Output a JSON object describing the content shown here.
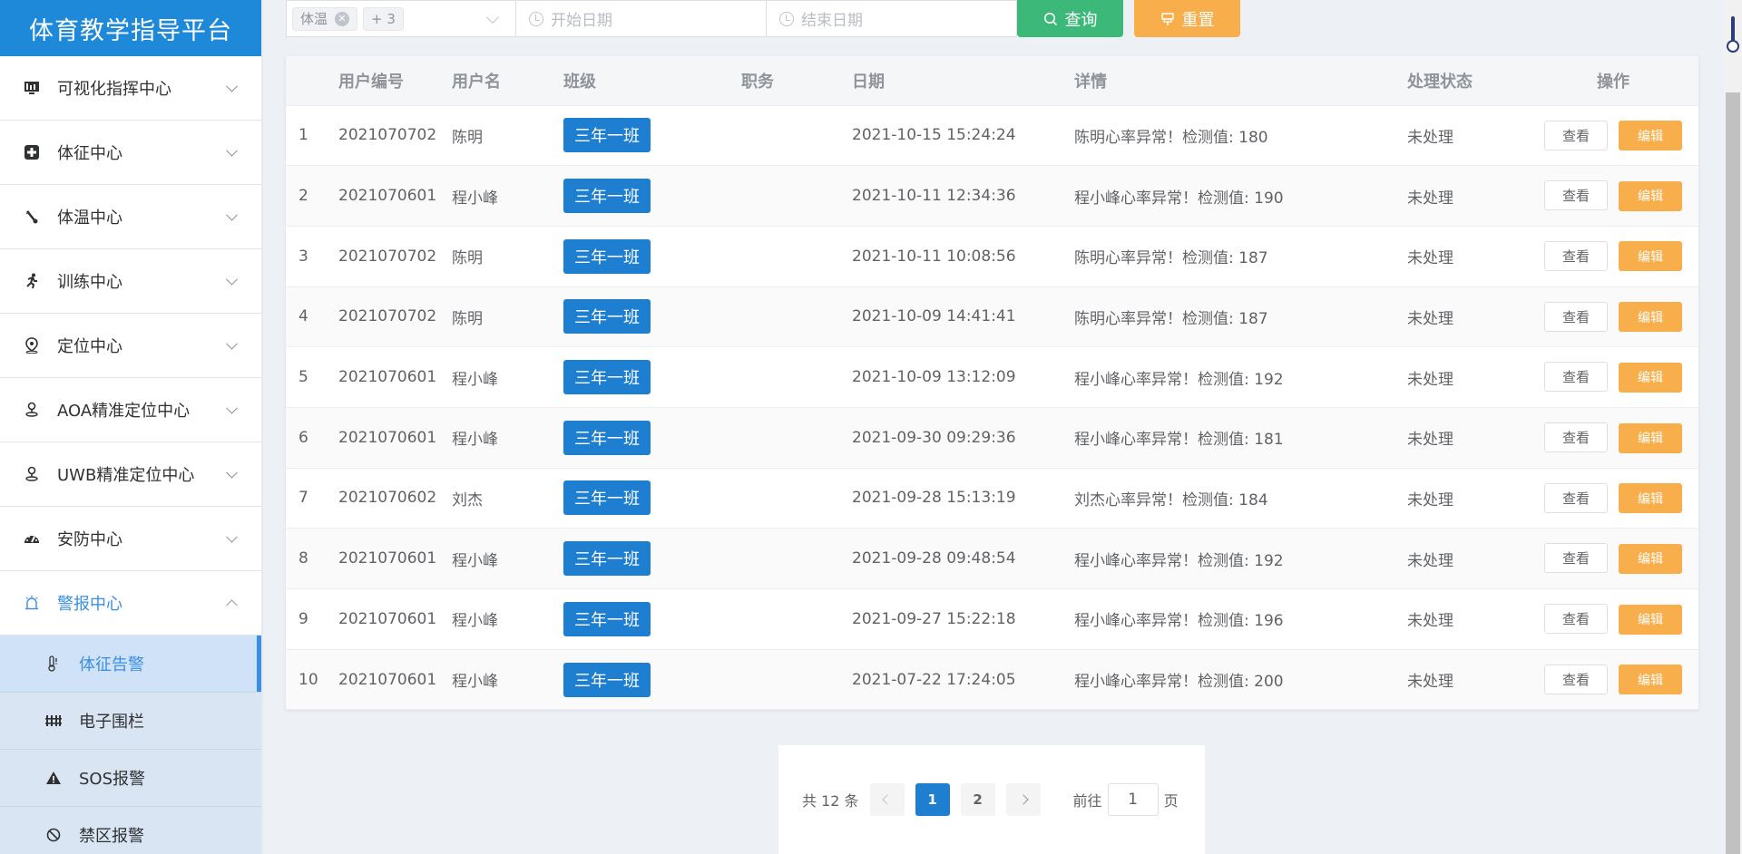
{
  "sidebar": {
    "title": "体育教学指导平台",
    "menu": [
      {
        "label": "可视化指挥中心",
        "icon": "monitor-icon"
      },
      {
        "label": "体征中心",
        "icon": "medical-cross-icon"
      },
      {
        "label": "体温中心",
        "icon": "thermometer-icon"
      },
      {
        "label": "训练中心",
        "icon": "running-icon"
      },
      {
        "label": "定位中心",
        "icon": "location-pin-icon"
      },
      {
        "label": "AOA精准定位中心",
        "icon": "locate-person-icon"
      },
      {
        "label": "UWB精准定位中心",
        "icon": "locate-person-icon"
      },
      {
        "label": "安防中心",
        "icon": "gauge-icon"
      },
      {
        "label": "警报中心",
        "icon": "alarm-icon"
      }
    ],
    "submenu": [
      {
        "label": "体征告警",
        "icon": "temperature-alert-icon"
      },
      {
        "label": "电子围栏",
        "icon": "fence-icon"
      },
      {
        "label": "SOS报警",
        "icon": "warning-icon"
      },
      {
        "label": "禁区报警",
        "icon": "forbidden-icon"
      }
    ]
  },
  "filters": {
    "type_tag": "体温",
    "more_tag": "+ 3",
    "start_placeholder": "开始日期",
    "end_placeholder": "结束日期",
    "query_label": "查询",
    "reset_label": "重置"
  },
  "table": {
    "headers": [
      "",
      "用户编号",
      "用户名",
      "班级",
      "职务",
      "日期",
      "详情",
      "处理状态",
      "操作"
    ],
    "rows": [
      {
        "idx": "1",
        "user_id": "2021070702",
        "name": "陈明",
        "class": "三年一班",
        "role": "",
        "date": "2021-10-15 15:24:24",
        "detail": "陈明心率异常！检测值: 180",
        "status": "未处理"
      },
      {
        "idx": "2",
        "user_id": "2021070601",
        "name": "程小峰",
        "class": "三年一班",
        "role": "",
        "date": "2021-10-11 12:34:36",
        "detail": "程小峰心率异常！检测值: 190",
        "status": "未处理"
      },
      {
        "idx": "3",
        "user_id": "2021070702",
        "name": "陈明",
        "class": "三年一班",
        "role": "",
        "date": "2021-10-11 10:08:56",
        "detail": "陈明心率异常！检测值: 187",
        "status": "未处理"
      },
      {
        "idx": "4",
        "user_id": "2021070702",
        "name": "陈明",
        "class": "三年一班",
        "role": "",
        "date": "2021-10-09 14:41:41",
        "detail": "陈明心率异常！检测值: 187",
        "status": "未处理"
      },
      {
        "idx": "5",
        "user_id": "2021070601",
        "name": "程小峰",
        "class": "三年一班",
        "role": "",
        "date": "2021-10-09 13:12:09",
        "detail": "程小峰心率异常！检测值: 192",
        "status": "未处理"
      },
      {
        "idx": "6",
        "user_id": "2021070601",
        "name": "程小峰",
        "class": "三年一班",
        "role": "",
        "date": "2021-09-30 09:29:36",
        "detail": "程小峰心率异常！检测值: 181",
        "status": "未处理"
      },
      {
        "idx": "7",
        "user_id": "2021070602",
        "name": "刘杰",
        "class": "三年一班",
        "role": "",
        "date": "2021-09-28 15:13:19",
        "detail": "刘杰心率异常！检测值: 184",
        "status": "未处理"
      },
      {
        "idx": "8",
        "user_id": "2021070601",
        "name": "程小峰",
        "class": "三年一班",
        "role": "",
        "date": "2021-09-28 09:48:54",
        "detail": "程小峰心率异常！检测值: 192",
        "status": "未处理"
      },
      {
        "idx": "9",
        "user_id": "2021070601",
        "name": "程小峰",
        "class": "三年一班",
        "role": "",
        "date": "2021-09-27 15:22:18",
        "detail": "程小峰心率异常！检测值: 196",
        "status": "未处理"
      },
      {
        "idx": "10",
        "user_id": "2021070601",
        "name": "程小峰",
        "class": "三年一班",
        "role": "",
        "date": "2021-07-22 17:24:05",
        "detail": "程小峰心率异常！检测值: 200",
        "status": "未处理"
      }
    ],
    "view_label": "查看",
    "edit_label": "编辑"
  },
  "pagination": {
    "total": "共 12 条",
    "pages": [
      "1",
      "2"
    ],
    "current_page": "1",
    "goto_label": "前往",
    "goto_value": "1",
    "page_suffix": "页"
  },
  "colors": {
    "brand": "#1e88d9",
    "query": "#3cb878",
    "reset": "#f8ae4a",
    "class_tag": "#1e7ed0"
  }
}
